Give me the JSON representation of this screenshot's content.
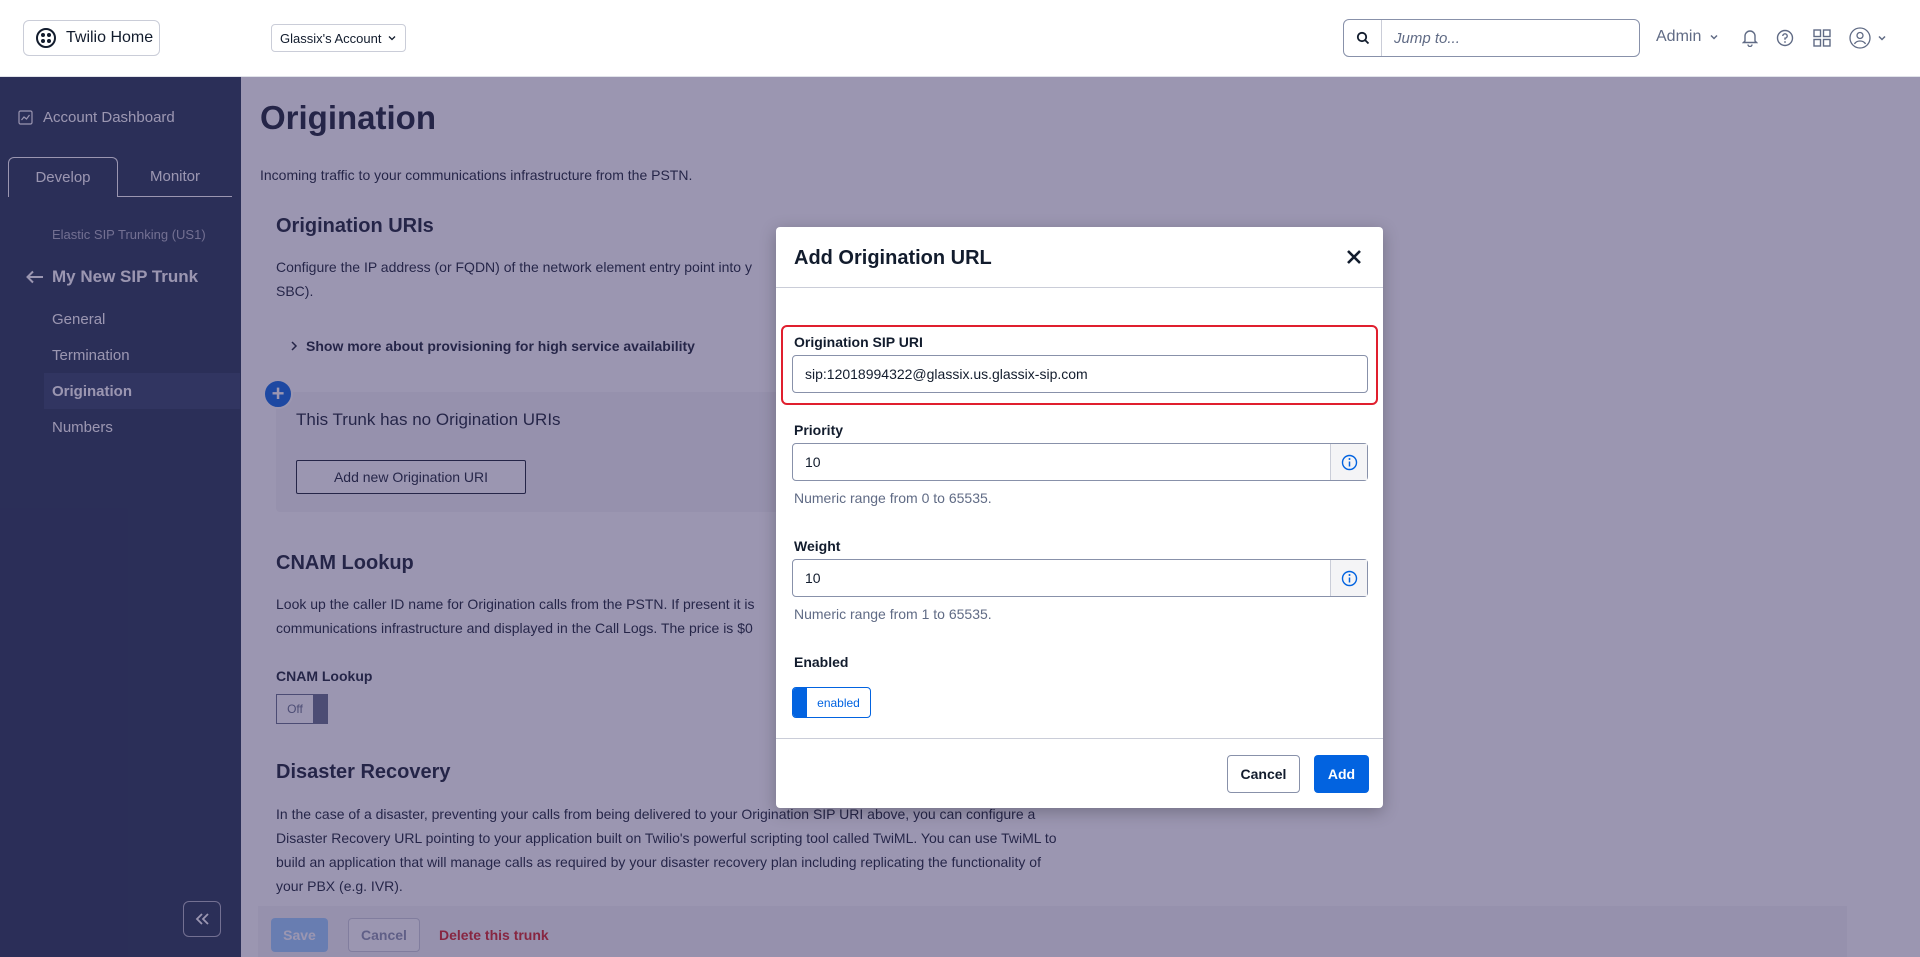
{
  "topbar": {
    "home_label": "Twilio Home",
    "account_label": "Glassix's Account",
    "search_placeholder": "Jump to...",
    "user_label": "Admin"
  },
  "sidebar": {
    "dashboard_label": "Account Dashboard",
    "tabs": [
      "Develop",
      "Monitor"
    ],
    "product_label": "Elastic SIP Trunking (US1)",
    "trunk_name": "My New SIP Trunk",
    "items": [
      {
        "label": "General",
        "active": false
      },
      {
        "label": "Termination",
        "active": false
      },
      {
        "label": "Origination",
        "active": true
      },
      {
        "label": "Numbers",
        "active": false
      }
    ]
  },
  "main": {
    "title": "Origination",
    "description": "Incoming traffic to your communications infrastructure from the PSTN.",
    "uris_heading": "Origination URIs",
    "uris_text_1": "Configure the IP address (or FQDN) of the network element entry point into y",
    "uris_text_2": "SBC).",
    "show_more": "Show more about provisioning for high service availability",
    "empty_text": "This Trunk has no Origination URIs",
    "add_uri_button": "Add new Origination URI",
    "cnam_heading": "CNAM Lookup",
    "cnam_text_1": "Look up the caller ID name for Origination calls from the PSTN. If present it is",
    "cnam_text_2": "communications infrastructure and displayed in the Call Logs. The price is $0",
    "cnam_label": "CNAM Lookup",
    "cnam_toggle": "Off",
    "dr_heading": "Disaster Recovery",
    "dr_text_1": "In the case of a disaster, preventing your calls from being delivered to your Origination SIP URI above, you can configure a",
    "dr_text_2": "Disaster Recovery URL pointing to your application built on Twilio's powerful scripting tool called TwiML. You can use TwiML to",
    "dr_text_3": "build an application that will manage calls as required by your disaster recovery plan including replicating the functionality of",
    "dr_text_4": "your PBX (e.g. IVR).",
    "save_button": "Save",
    "cancel_button": "Cancel",
    "delete_link": "Delete this trunk"
  },
  "modal": {
    "title": "Add Origination URL",
    "sip_label": "Origination SIP URI",
    "sip_value": "sip:12018994322@glassix.us.glassix-sip.com",
    "priority_label": "Priority",
    "priority_value": "10",
    "priority_help": "Numeric range from 0 to 65535.",
    "weight_label": "Weight",
    "weight_value": "10",
    "weight_help": "Numeric range from 1 to 65535.",
    "enabled_label": "Enabled",
    "enabled_toggle": "enabled",
    "cancel_button": "Cancel",
    "add_button": "Add"
  },
  "colors": {
    "primary": "#0263e0",
    "sidebar_bg": "#1f304c",
    "highlight": "#e01f2e",
    "danger": "#d61f1f"
  }
}
